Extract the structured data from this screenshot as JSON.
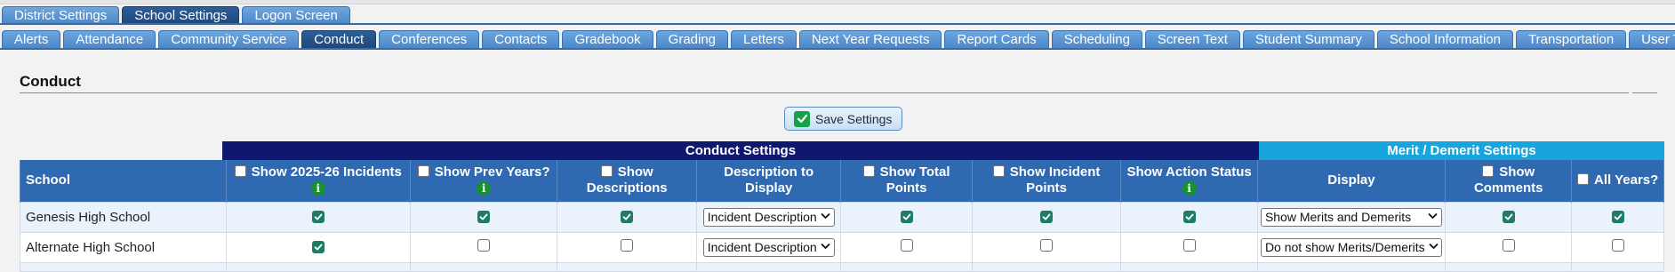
{
  "tabs_row1": [
    {
      "label": "District Settings",
      "active": false
    },
    {
      "label": "School Settings",
      "active": true
    },
    {
      "label": "Logon Screen",
      "active": false
    }
  ],
  "tabs_row2": [
    {
      "label": "Alerts",
      "active": false
    },
    {
      "label": "Attendance",
      "active": false
    },
    {
      "label": "Community Service",
      "active": false
    },
    {
      "label": "Conduct",
      "active": true
    },
    {
      "label": "Conferences",
      "active": false
    },
    {
      "label": "Contacts",
      "active": false
    },
    {
      "label": "Gradebook",
      "active": false
    },
    {
      "label": "Grading",
      "active": false
    },
    {
      "label": "Letters",
      "active": false
    },
    {
      "label": "Next Year Requests",
      "active": false
    },
    {
      "label": "Report Cards",
      "active": false
    },
    {
      "label": "Scheduling",
      "active": false
    },
    {
      "label": "Screen Text",
      "active": false
    },
    {
      "label": "Student Summary",
      "active": false
    },
    {
      "label": "School Information",
      "active": false
    },
    {
      "label": "Transportation",
      "active": false
    },
    {
      "label": "User Text/Flags",
      "active": false
    }
  ],
  "section": {
    "title": "Conduct"
  },
  "save_button": {
    "label": "Save Settings",
    "icon": "checkmark-icon"
  },
  "bands": {
    "conduct": "Conduct Settings",
    "merit": "Merit / Demerit Settings"
  },
  "columns": {
    "school": "School",
    "show_incidents": "Show 2025-26 Incidents",
    "show_prev_years": "Show Prev Years?",
    "show_descriptions": "Show Descriptions",
    "description_to_display": "Description to Display",
    "show_total_points": "Show Total Points",
    "show_incident_points": "Show Incident Points",
    "show_action_status": "Show Action Status",
    "display": "Display",
    "show_comments": "Show Comments",
    "all_years": "All Years?"
  },
  "rows": [
    {
      "school": "Genesis High School",
      "show_incidents": true,
      "show_prev_years": true,
      "show_descriptions": true,
      "description_to_display": "Incident Description",
      "show_total_points": true,
      "show_incident_points": true,
      "show_action_status": true,
      "display": "Show Merits and Demerits",
      "show_comments": true,
      "all_years": true
    },
    {
      "school": "Alternate High School",
      "show_incidents": true,
      "show_prev_years": false,
      "show_descriptions": false,
      "description_to_display": "Incident Description",
      "show_total_points": false,
      "show_incident_points": false,
      "show_action_status": false,
      "display": "Do not show Merits/Demerits",
      "show_comments": false,
      "all_years": false
    }
  ],
  "colors": {
    "tab": "#4a86c8",
    "tab_active": "#1d4779",
    "header": "#2f69b1",
    "conduct_band": "#10176e",
    "merit_band": "#18a4dc",
    "check": "#1e7b64",
    "info": "#18912f"
  }
}
